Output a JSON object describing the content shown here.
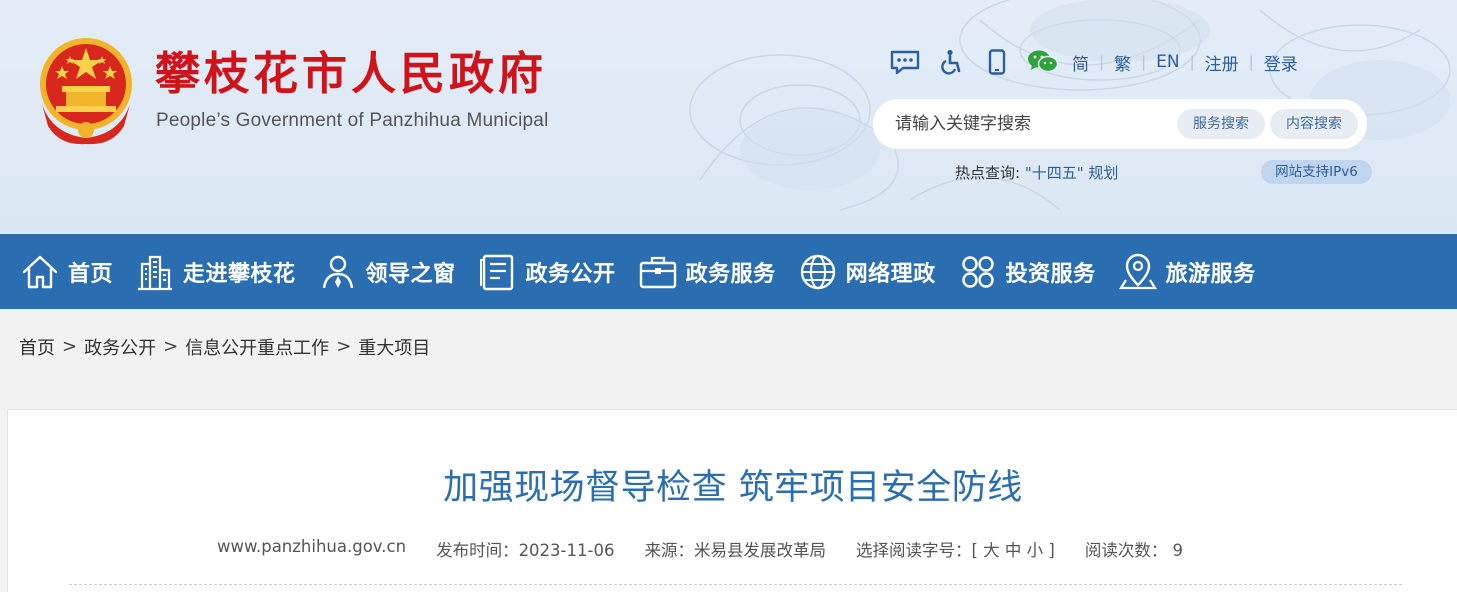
{
  "header": {
    "title": "攀枝花市人民政府",
    "subtitle": "People’s Government of Panzhihua Municipal",
    "tools": {
      "icons": [
        "message-icon",
        "accessibility-icon",
        "mobile-icon",
        "wechat-icon"
      ],
      "links": [
        "简",
        "繁",
        "EN",
        "注册",
        "登录"
      ]
    },
    "search": {
      "placeholder": "请输入关键字搜索",
      "service_search": "服务搜索",
      "content_search": "内容搜索"
    },
    "hot": {
      "label": "热点查询:",
      "term": "\"十四五\" 规划"
    },
    "ipv6": "网站支持IPv6"
  },
  "nav": {
    "items": [
      {
        "label": "首页",
        "icon": "home-icon"
      },
      {
        "label": "走进攀枝花",
        "icon": "city-icon"
      },
      {
        "label": "领导之窗",
        "icon": "person-icon"
      },
      {
        "label": "政务公开",
        "icon": "document-icon"
      },
      {
        "label": "政务服务",
        "icon": "briefcase-icon"
      },
      {
        "label": "网络理政",
        "icon": "globe-icon"
      },
      {
        "label": "投资服务",
        "icon": "grid-icon"
      },
      {
        "label": "旅游服务",
        "icon": "location-icon"
      }
    ]
  },
  "breadcrumb": [
    "首页",
    "政务公开",
    "信息公开重点工作",
    "重大项目"
  ],
  "article": {
    "title": "加强现场督导检查 筑牢项目安全防线",
    "site": "www.panzhihua.gov.cn",
    "publish": "发布时间：2023-11-06",
    "source": "来源：米易县发展改革局",
    "font_size": "选择阅读字号：[ 大 中 小 ]",
    "reads": "阅读次数： 9"
  },
  "colors": {
    "brand_red": "#d0121b",
    "nav_blue": "#2a6db0",
    "link_blue": "#2c5e9e"
  }
}
